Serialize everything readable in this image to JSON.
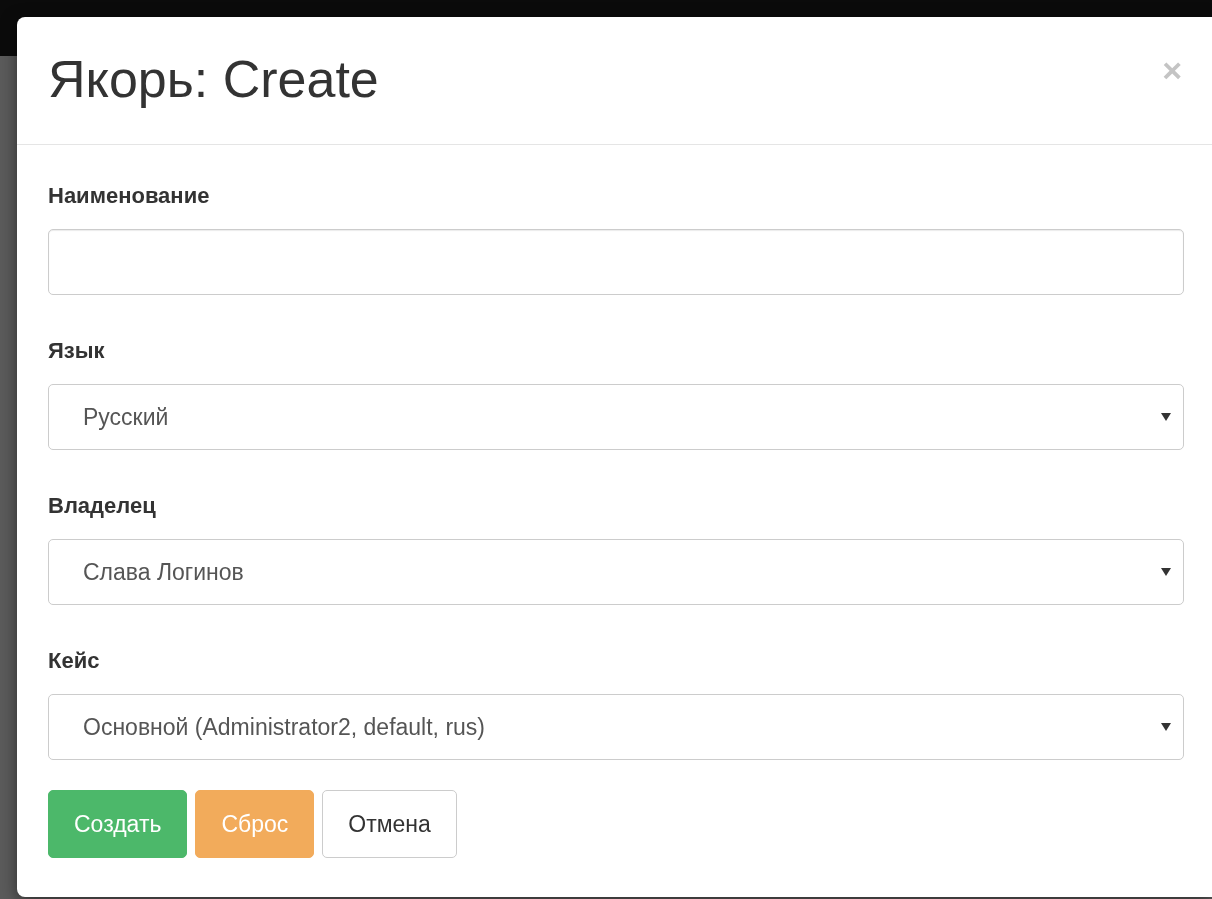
{
  "modal": {
    "title": "Якорь: Create",
    "close": "×"
  },
  "fields": [
    {
      "kind": "text",
      "label": "Наименование"
    },
    {
      "kind": "select",
      "label": "Язык",
      "value": "Русский"
    },
    {
      "kind": "select",
      "label": "Владелец",
      "value": "Слава Логинов"
    },
    {
      "kind": "select",
      "label": "Кейс",
      "value": "Основной (Administrator2, default, rus)"
    }
  ],
  "buttons": [
    {
      "kind": "success",
      "label": "Создать"
    },
    {
      "kind": "warning",
      "label": "Сброс"
    },
    {
      "kind": "default",
      "label": "Отмена"
    }
  ]
}
